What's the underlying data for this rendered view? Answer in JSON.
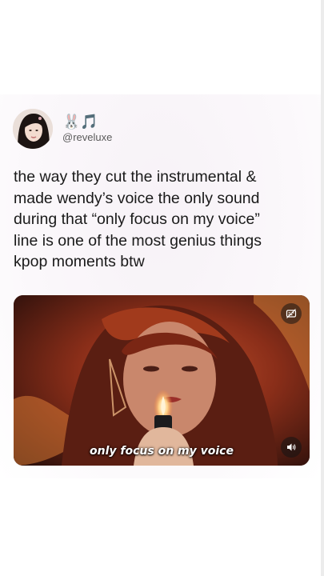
{
  "tweet": {
    "display_name": "🐰🎵",
    "handle": "@reveluxe",
    "text": "the way they cut the instrumental &\nmade wendy’s voice the only sound\nduring that “only focus on my voice”\nline is one of the most genius things\nkpop moments btw",
    "avatar_icon": "profile-photo",
    "media": {
      "subtitle": "only focus on my voice",
      "captions_icon": "captions-off-icon",
      "sound_icon": "speaker-icon"
    }
  }
}
